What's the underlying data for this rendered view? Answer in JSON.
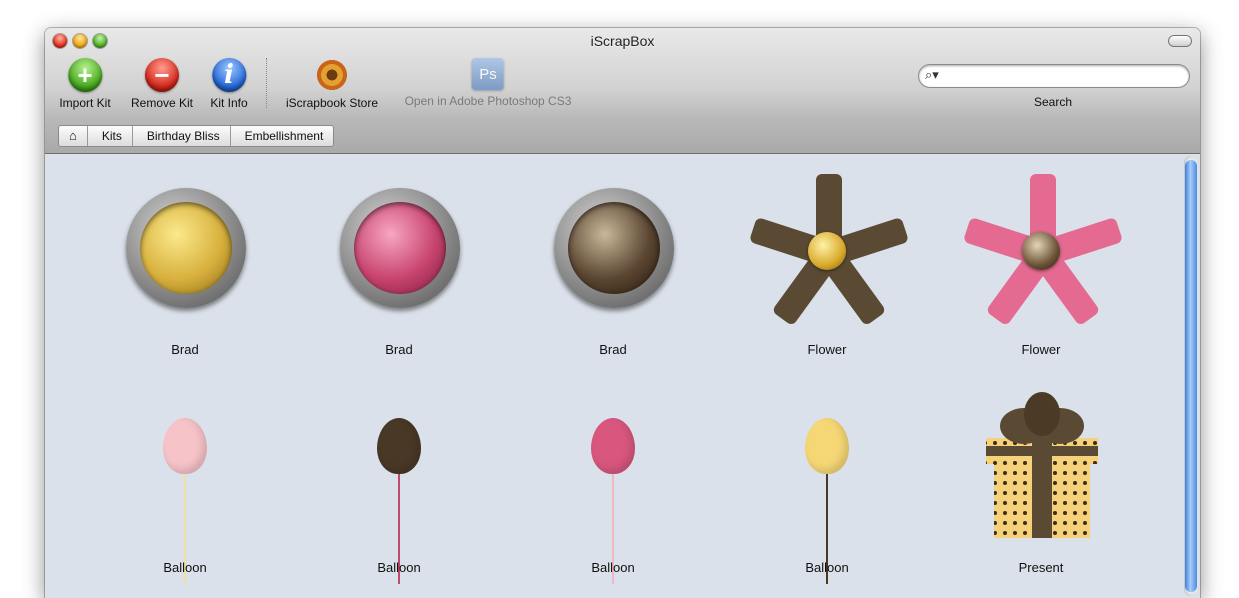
{
  "window": {
    "title": "iScrapBox"
  },
  "toolbar": {
    "import_label": "Import Kit",
    "remove_label": "Remove Kit",
    "info_label": "Kit Info",
    "store_label": "iScrapbook Store",
    "photoshop_label": "Open in Adobe Photoshop CS3",
    "ps_icon_text": "Ps",
    "search_label": "Search",
    "search_placeholder": ""
  },
  "breadcrumb": [
    "Kits",
    "Birthday Bliss",
    "Embellishment"
  ],
  "items": [
    {
      "label": "Brad",
      "kind": "brad",
      "color": "#d8b13e"
    },
    {
      "label": "Brad",
      "kind": "brad",
      "color": "#c8446f"
    },
    {
      "label": "Brad",
      "kind": "brad",
      "color": "#5b4632"
    },
    {
      "label": "Flower",
      "kind": "flower",
      "color": "#5a4a34"
    },
    {
      "label": "Flower",
      "kind": "flower",
      "color": "#e56a92"
    },
    {
      "label": "Balloon",
      "kind": "balloon",
      "color": "#f6c3c8"
    },
    {
      "label": "Balloon",
      "kind": "balloon",
      "color": "#4a3826"
    },
    {
      "label": "Balloon",
      "kind": "balloon",
      "color": "#d9577e"
    },
    {
      "label": "Balloon",
      "kind": "balloon",
      "color": "#f6d776"
    },
    {
      "label": "Present",
      "kind": "present",
      "color": "#f5d27a"
    }
  ]
}
